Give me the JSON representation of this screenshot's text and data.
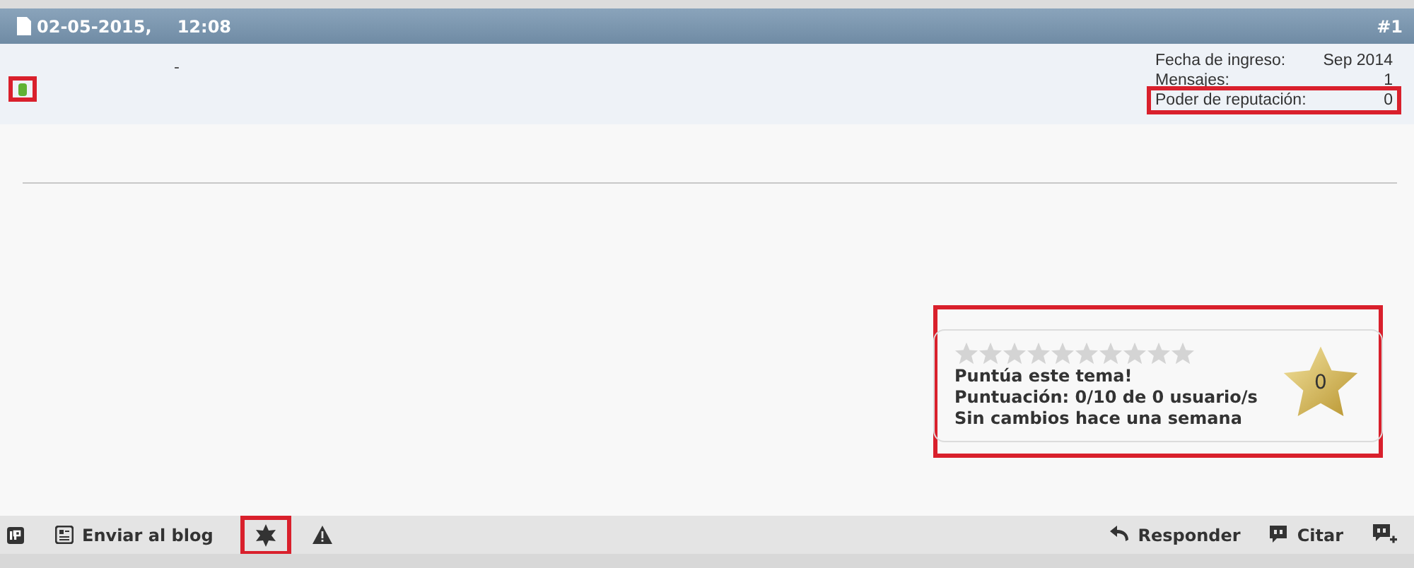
{
  "post": {
    "date": "02-05-2015,",
    "time": "12:08",
    "number": "#1"
  },
  "user": {
    "separator": "-",
    "status_highlighted": true,
    "stats": [
      {
        "label": "Fecha de ingreso:",
        "value": "Sep 2014",
        "highlighted": false
      },
      {
        "label": "Mensajes:",
        "value": "1",
        "highlighted": false
      },
      {
        "label": "Poder de reputación:",
        "value": "0",
        "highlighted": true
      }
    ]
  },
  "rating": {
    "highlighted": true,
    "stars": 0,
    "lines": [
      "Puntúa este tema!",
      "Puntuación: 0/10 de 0 usuario/s",
      "Sin cambios hace una semana"
    ],
    "score": "0"
  },
  "footer": {
    "left": [
      {
        "kind": "ip",
        "highlighted": false
      },
      {
        "kind": "blog",
        "label": "Enviar al blog",
        "highlighted": false
      },
      {
        "kind": "star",
        "highlighted": true
      },
      {
        "kind": "warning",
        "highlighted": false
      }
    ],
    "right": [
      {
        "kind": "reply",
        "label": "Responder"
      },
      {
        "kind": "quote",
        "label": "Citar"
      },
      {
        "kind": "multiquote"
      }
    ]
  }
}
